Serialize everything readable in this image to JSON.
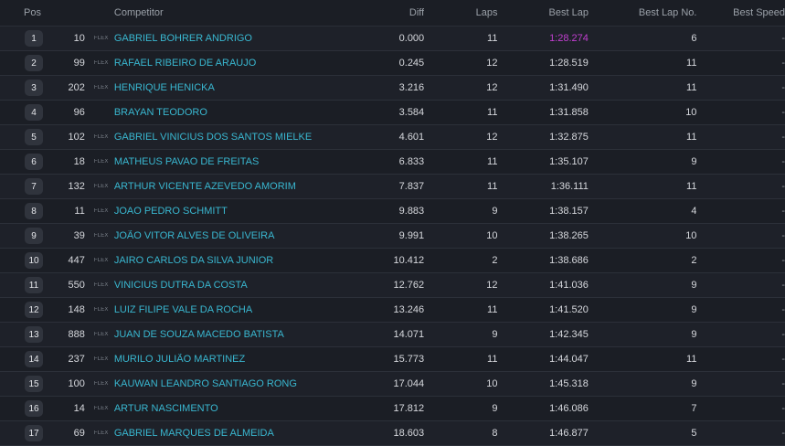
{
  "columns": {
    "pos": "Pos",
    "competitor": "Competitor",
    "diff": "Diff",
    "laps": "Laps",
    "best_lap": "Best Lap",
    "best_lap_no": "Best Lap No.",
    "best_speed": "Best Speed"
  },
  "colors": {
    "background": "#1b1e25",
    "competitor_link": "#39b7d0",
    "fastest_lap": "#c23fd0"
  },
  "rows": [
    {
      "pos": "1",
      "num": "10",
      "cls": "FLEX",
      "name": "GABRIEL BOHRER ANDRIGO",
      "diff": "0.000",
      "laps": "11",
      "best": "1:28.274",
      "bestno": "6",
      "speed": "-"
    },
    {
      "pos": "2",
      "num": "99",
      "cls": "FLEX",
      "name": "RAFAEL RIBEIRO DE ARAUJO",
      "diff": "0.245",
      "laps": "12",
      "best": "1:28.519",
      "bestno": "11",
      "speed": "-"
    },
    {
      "pos": "3",
      "num": "202",
      "cls": "FLEX",
      "name": "HENRIQUE HENICKA",
      "diff": "3.216",
      "laps": "12",
      "best": "1:31.490",
      "bestno": "11",
      "speed": "-"
    },
    {
      "pos": "4",
      "num": "96",
      "cls": "",
      "name": "BRAYAN TEODORO",
      "diff": "3.584",
      "laps": "11",
      "best": "1:31.858",
      "bestno": "10",
      "speed": "-"
    },
    {
      "pos": "5",
      "num": "102",
      "cls": "FLEX",
      "name": "GABRIEL VINICIUS DOS SANTOS MIELKE",
      "diff": "4.601",
      "laps": "12",
      "best": "1:32.875",
      "bestno": "11",
      "speed": "-"
    },
    {
      "pos": "6",
      "num": "18",
      "cls": "FLEX",
      "name": "MATHEUS PAVAO DE FREITAS",
      "diff": "6.833",
      "laps": "11",
      "best": "1:35.107",
      "bestno": "9",
      "speed": "-"
    },
    {
      "pos": "7",
      "num": "132",
      "cls": "FLEX",
      "name": "ARTHUR VICENTE AZEVEDO AMORIM",
      "diff": "7.837",
      "laps": "11",
      "best": "1:36.111",
      "bestno": "11",
      "speed": "-"
    },
    {
      "pos": "8",
      "num": "11",
      "cls": "FLEX",
      "name": "JOAO PEDRO SCHMITT",
      "diff": "9.883",
      "laps": "9",
      "best": "1:38.157",
      "bestno": "4",
      "speed": "-"
    },
    {
      "pos": "9",
      "num": "39",
      "cls": "FLEX",
      "name": "JOÃO VITOR ALVES DE OLIVEIRA",
      "diff": "9.991",
      "laps": "10",
      "best": "1:38.265",
      "bestno": "10",
      "speed": "-"
    },
    {
      "pos": "10",
      "num": "447",
      "cls": "FLEX",
      "name": "JAIRO CARLOS DA SILVA JUNIOR",
      "diff": "10.412",
      "laps": "2",
      "best": "1:38.686",
      "bestno": "2",
      "speed": "-"
    },
    {
      "pos": "11",
      "num": "550",
      "cls": "FLEX",
      "name": "VINICIUS DUTRA DA COSTA",
      "diff": "12.762",
      "laps": "12",
      "best": "1:41.036",
      "bestno": "9",
      "speed": "-"
    },
    {
      "pos": "12",
      "num": "148",
      "cls": "FLEX",
      "name": "LUIZ FILIPE VALE DA ROCHA",
      "diff": "13.246",
      "laps": "11",
      "best": "1:41.520",
      "bestno": "9",
      "speed": "-"
    },
    {
      "pos": "13",
      "num": "888",
      "cls": "FLEX",
      "name": "JUAN DE SOUZA MACEDO BATISTA",
      "diff": "14.071",
      "laps": "9",
      "best": "1:42.345",
      "bestno": "9",
      "speed": "-"
    },
    {
      "pos": "14",
      "num": "237",
      "cls": "FLEX",
      "name": "MURILO JULIÃO MARTINEZ",
      "diff": "15.773",
      "laps": "11",
      "best": "1:44.047",
      "bestno": "11",
      "speed": "-"
    },
    {
      "pos": "15",
      "num": "100",
      "cls": "FLEX",
      "name": "KAUWAN LEANDRO SANTIAGO RONG",
      "diff": "17.044",
      "laps": "10",
      "best": "1:45.318",
      "bestno": "9",
      "speed": "-"
    },
    {
      "pos": "16",
      "num": "14",
      "cls": "FLEX",
      "name": "ARTUR NASCIMENTO",
      "diff": "17.812",
      "laps": "9",
      "best": "1:46.086",
      "bestno": "7",
      "speed": "-"
    },
    {
      "pos": "17",
      "num": "69",
      "cls": "FLEX",
      "name": "GABRIEL MARQUES DE ALMEIDA",
      "diff": "18.603",
      "laps": "8",
      "best": "1:46.877",
      "bestno": "5",
      "speed": "-"
    }
  ]
}
